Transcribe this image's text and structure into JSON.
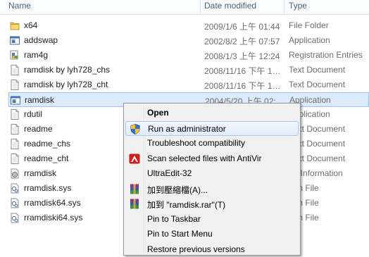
{
  "header": {
    "name": "Name",
    "date": "Date modified",
    "type": "Type"
  },
  "files": [
    {
      "name": "x64",
      "date": "2009/1/6 上午 01:44",
      "type": "File Folder",
      "icon": "folder-icon"
    },
    {
      "name": "addswap",
      "date": "2002/8/2 上午 07:57",
      "type": "Application",
      "icon": "application-icon"
    },
    {
      "name": "ram4g",
      "date": "2008/1/3 上午 12:24",
      "type": "Registration Entries",
      "icon": "registry-file-icon"
    },
    {
      "name": "ramdisk by lyh728_chs",
      "date": "2008/11/16 下午 1…",
      "type": "Text Document",
      "icon": "text-document-icon"
    },
    {
      "name": "ramdisk by lyh728_cht",
      "date": "2008/11/16 下午 1…",
      "type": "Text Document",
      "icon": "text-document-icon"
    },
    {
      "name": "ramdisk",
      "date": "2004/5/20 上午 02:…",
      "type": "Application",
      "icon": "application-icon",
      "selected": true
    },
    {
      "name": "rdutil",
      "date": "",
      "type": "Application",
      "icon": "text-document-icon"
    },
    {
      "name": "readme",
      "date": "",
      "type": "Text Document",
      "icon": "text-document-icon"
    },
    {
      "name": "readme_chs",
      "date": "",
      "type": "Text Document",
      "icon": "text-document-icon"
    },
    {
      "name": "readme_cht",
      "date": "",
      "type": "Text Document",
      "icon": "text-document-icon"
    },
    {
      "name": "rramdisk",
      "date": "",
      "type": "up Information",
      "icon": "setup-info-icon"
    },
    {
      "name": "rramdisk.sys",
      "date": "",
      "type": "tem File",
      "icon": "system-file-icon"
    },
    {
      "name": "rramdisk64.sys",
      "date": "",
      "type": "tem File",
      "icon": "system-file-icon"
    },
    {
      "name": "rramdiski64.sys",
      "date": "",
      "type": "tem File",
      "icon": "system-file-icon"
    }
  ],
  "context_menu": [
    {
      "label": "Open",
      "bold": true,
      "icon": ""
    },
    {
      "label": "Run as administrator",
      "icon": "uac-shield-icon",
      "highlighted": true
    },
    {
      "label": "Troubleshoot compatibility",
      "icon": ""
    },
    {
      "label": "Scan selected files with AntiVir",
      "icon": "antivir-icon"
    },
    {
      "label": "UltraEdit-32",
      "icon": ""
    },
    {
      "label": "加到壓縮檔(A)...",
      "icon": "winrar-icon"
    },
    {
      "label": "加到 \"ramdisk.rar\"(T)",
      "icon": "winrar-icon"
    },
    {
      "label": "Pin to Taskbar",
      "icon": ""
    },
    {
      "label": "Pin to Start Menu",
      "icon": ""
    },
    {
      "label": "Restore previous versions",
      "icon": ""
    }
  ]
}
